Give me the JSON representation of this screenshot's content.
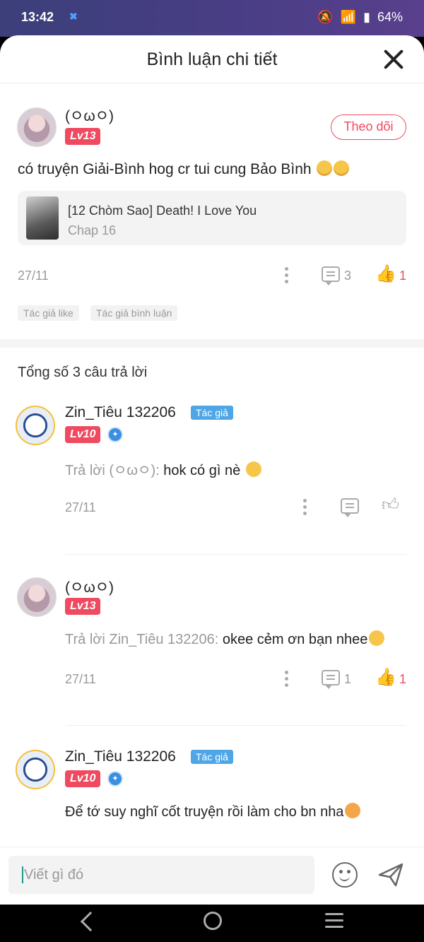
{
  "status_bar": {
    "time": "13:42",
    "battery": "64%",
    "icons": [
      "notifications-off-icon",
      "wifi-icon",
      "signal-icon",
      "battery-icon"
    ]
  },
  "header": {
    "title": "Bình luận chi tiết",
    "close_icon": "close-icon"
  },
  "main_comment": {
    "username": "(ㅇωㅇ)",
    "level": "Lv13",
    "follow_label": "Theo dõi",
    "text": "có truyện Giải-Bình hog cr tui cung Bảo Bình",
    "story": {
      "title": "[12 Chòm Sao] Death! I Love You",
      "chapter": "Chap 16"
    },
    "date": "27/11",
    "comment_count": "3",
    "like_count": "1",
    "tags": [
      "Tác giả like",
      "Tác giả bình luận"
    ]
  },
  "replies_total": "Tổng số 3 câu trả lời",
  "replies": [
    {
      "username": "Zin_Tiêu 132206",
      "author_tag": "Tác giả",
      "level": "Lv10",
      "reply_prefix": "Trả lời (ㅇωㅇ):",
      "text": " hok có gì nè",
      "date": "27/11"
    },
    {
      "username": "(ㅇωㅇ)",
      "level": "Lv13",
      "reply_prefix": "Trả lời Zin_Tiêu 132206:",
      "text": " okee cẻm ơn bạn nhee",
      "date": "27/11",
      "comment_count": "1",
      "like_count": "1"
    },
    {
      "username": "Zin_Tiêu 132206",
      "author_tag": "Tác giả",
      "level": "Lv10",
      "text": "Để tớ suy nghĩ cốt truyện rồi làm cho bn nha"
    }
  ],
  "input": {
    "placeholder": "Viết gì đó"
  },
  "colors": {
    "accent": "#ef4a5f",
    "author_tag": "#4fa6e6",
    "muted": "#999999"
  }
}
